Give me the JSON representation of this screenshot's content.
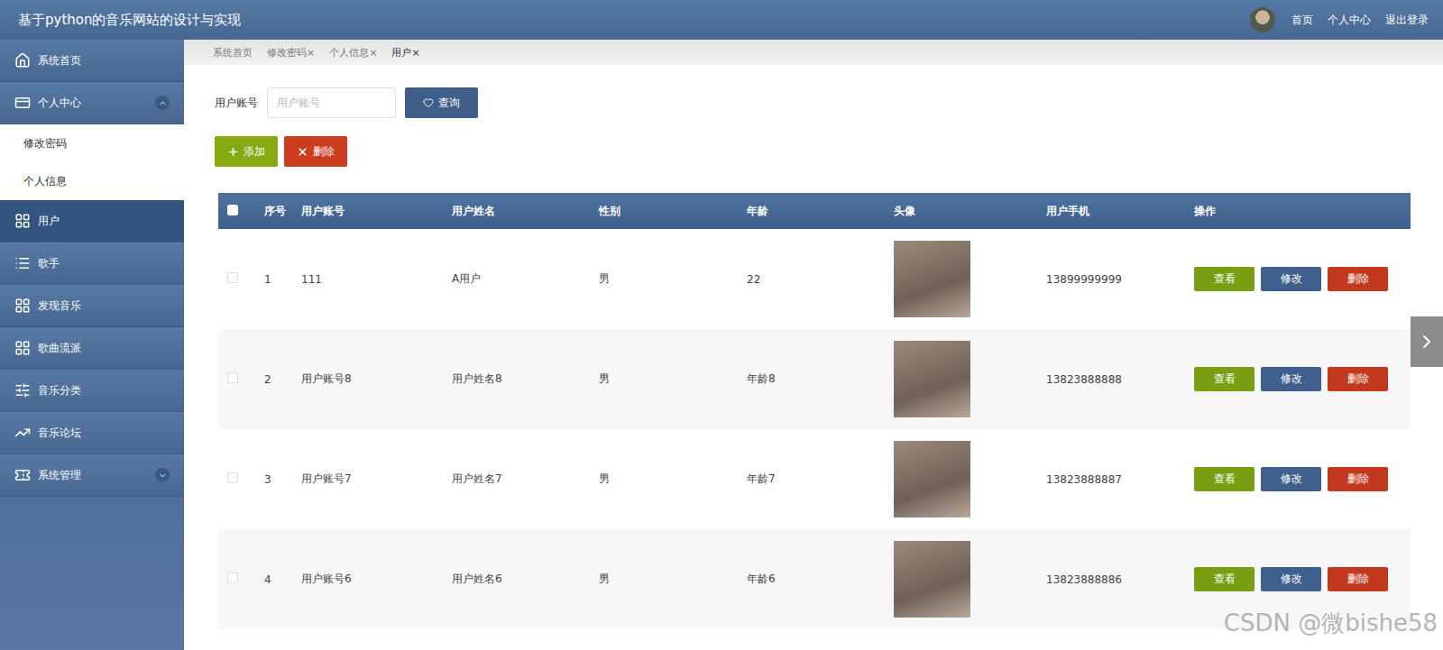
{
  "window": {
    "title": "基于python的音乐网站的设计与实现"
  },
  "header_nav": [
    "首页",
    "个人中心",
    "退出登录"
  ],
  "sidebar": {
    "items": [
      {
        "label": "系统首页",
        "kind": "link",
        "selected": false,
        "expanded": false,
        "children": []
      },
      {
        "label": "个人中心",
        "kind": "group",
        "selected": false,
        "expanded": true,
        "children": [
          {
            "label": "修改密码",
            "selected": false
          },
          {
            "label": "个人信息",
            "selected": false
          }
        ]
      },
      {
        "label": "用户",
        "kind": "link",
        "selected": true,
        "expanded": false,
        "children": []
      },
      {
        "label": "歌手",
        "kind": "link",
        "selected": false,
        "expanded": false,
        "children": []
      },
      {
        "label": "发现音乐",
        "kind": "link",
        "selected": false,
        "expanded": false,
        "children": []
      },
      {
        "label": "歌曲流派",
        "kind": "link",
        "selected": false,
        "expanded": false,
        "children": []
      },
      {
        "label": "音乐分类",
        "kind": "link",
        "selected": false,
        "expanded": false,
        "children": []
      },
      {
        "label": "音乐论坛",
        "kind": "link",
        "selected": false,
        "expanded": false,
        "children": []
      },
      {
        "label": "系统管理",
        "kind": "group",
        "selected": false,
        "expanded": false,
        "children": []
      }
    ]
  },
  "tabs": [
    {
      "label": "系统首页",
      "close": "",
      "selected": false
    },
    {
      "label": "修改密码",
      "close": "×",
      "selected": false
    },
    {
      "label": "个人信息",
      "close": "×",
      "selected": false
    },
    {
      "label": "用户",
      "close": "×",
      "selected": true
    }
  ],
  "search": {
    "label": "用户账号",
    "placeholder": "用户账号",
    "value": "",
    "button": "查询"
  },
  "actions": [
    "添加",
    "删除"
  ],
  "table": {
    "all_checked": false,
    "columns": [
      "序号",
      "用户账号",
      "用户姓名",
      "性别",
      "年龄",
      "头像",
      "用户手机",
      "操作"
    ],
    "row_actions": [
      "查看",
      "修改",
      "删除"
    ],
    "rows": [
      {
        "index": "1",
        "account": "111",
        "name": "A用户",
        "gender": "男",
        "age": "22",
        "phone": "13899999999",
        "checked": false
      },
      {
        "index": "2",
        "account": "用户账号8",
        "name": "用户姓名8",
        "gender": "男",
        "age": "年龄8",
        "phone": "13823888888",
        "checked": false
      },
      {
        "index": "3",
        "account": "用户账号7",
        "name": "用户姓名7",
        "gender": "男",
        "age": "年龄7",
        "phone": "13823888887",
        "checked": false
      },
      {
        "index": "4",
        "account": "用户账号6",
        "name": "用户姓名6",
        "gender": "男",
        "age": "年龄6",
        "phone": "13823888886",
        "checked": false
      }
    ]
  },
  "watermark": "CSDN @微bishe58"
}
